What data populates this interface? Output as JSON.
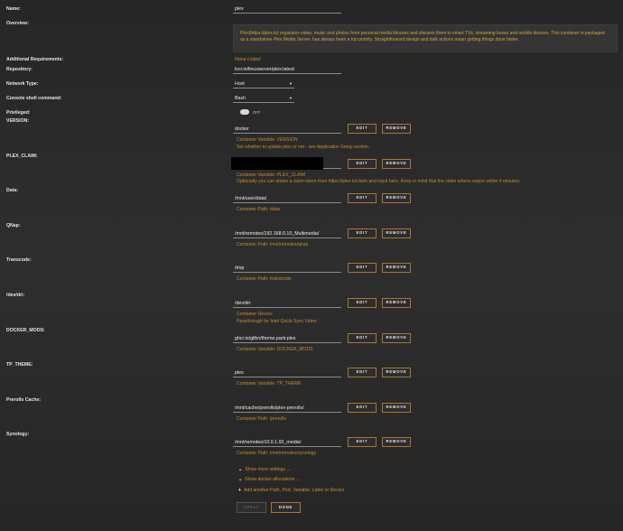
{
  "name": {
    "label": "Name:",
    "value": "plex"
  },
  "overview": {
    "label": "Overview:",
    "text": "Plex(https://plex.tv) organizes video, music and photos from personal media libraries and streams them to smart TVs, streaming boxes and mobile devices. This container is packaged as a standalone Plex Media Server. has always been a top priority. Straightforward design and bulk actions mean getting things done faster."
  },
  "additional": {
    "label": "Additional Requirements:",
    "value": "None Listed"
  },
  "repository": {
    "label": "Repository:",
    "value": "lscr.io/linuxserver/plex:latest"
  },
  "network": {
    "label": "Network Type:",
    "value": "Host"
  },
  "console": {
    "label": "Console shell command:",
    "value": "Bash"
  },
  "privileged": {
    "label": "Privileged:",
    "value": "OFF"
  },
  "buttons": {
    "edit": "EDIT",
    "remove": "REMOVE",
    "apply": "APPLY",
    "done": "DONE"
  },
  "config": [
    {
      "label": "VERSION:",
      "value": "docker",
      "notes": [
        "Container Variable: VERSION",
        "Set whether to update plex or not - see Application Setup section."
      ]
    },
    {
      "label": "PLEX_CLAIM:",
      "value": "",
      "redacted": true,
      "notes": [
        "Container Variable: PLEX_CLAIM",
        "Optionally you can obtain a claim token from https://plex.tv/claim and input here. Keep in mind that the claim tokens expire within 4 minutes."
      ]
    },
    {
      "label": "Data:",
      "value": "/mnt/user/data/",
      "notes": [
        "Container Path: /data"
      ]
    },
    {
      "label": "QNap:",
      "value": "/mnt/remotes/192.168.0.10_Multimedia/",
      "notes": [
        "Container Path: /mnt/remotes/qnap"
      ]
    },
    {
      "label": "Transcode:",
      "value": "/tmp",
      "notes": [
        "Container Path: /transcode"
      ]
    },
    {
      "label": "/dev/dri:",
      "value": "/dev/dri",
      "notes": [
        "Container Device:",
        "Passthrough for Intel Quick Sync Video"
      ]
    },
    {
      "label": "DOCKER_MODS:",
      "value": "ghcr.io/gilbn/theme.park:plex",
      "notes": [
        "Container Variable: DOCKER_MODS"
      ]
    },
    {
      "label": "TP_THEME:",
      "value": "plex",
      "notes": [
        "Container Variable: TP_THEME"
      ]
    },
    {
      "label": "Prerolls Cache:",
      "value": "/mnt/cache/prerolls/plex-prerolls/",
      "notes": [
        "Container Path: /prerolls"
      ]
    },
    {
      "label": "Synology:",
      "value": "/mnt/remotes/10.0.1.92_media/",
      "notes": [
        "Container Path: /mnt/remotes/synology"
      ]
    }
  ],
  "links": {
    "more_settings": "Show more settings ...",
    "docker_alloc": "Show docker allocations ...",
    "add_another": "Add another Path, Port, Variable, Label or Device"
  }
}
